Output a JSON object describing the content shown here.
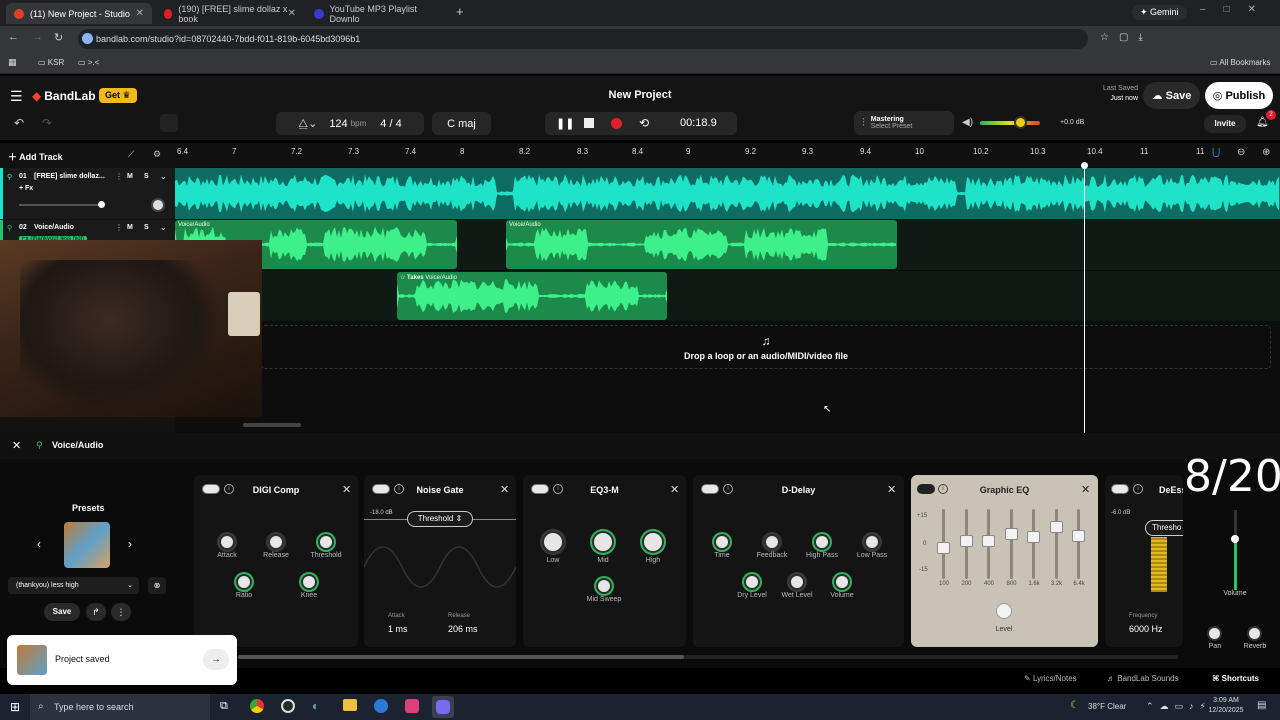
{
  "browser": {
    "tabs": [
      {
        "title": "(11) New Project - Studio",
        "active": true
      },
      {
        "title": "(190) [FREE] slime dollaz x book",
        "active": false
      },
      {
        "title": "YouTube MP3 Playlist Downlo",
        "active": false
      }
    ],
    "gemini_label": "Gemini",
    "url": "bandlab.com/studio?id=08702440-7bdd-f011-819b-6045bd3096b1",
    "bookmarks": [
      "KSR",
      ">.<"
    ],
    "all_bookmarks": "All Bookmarks"
  },
  "app": {
    "brand": "BandLab",
    "get_label": "Get",
    "project_title": "New Project",
    "bpm": "124",
    "bpm_unit": "bpm",
    "time_sig": "4 / 4",
    "key": "C maj",
    "time": "00:18.9",
    "mastering_title": "Mastering",
    "mastering_sub": "Select Preset",
    "master_db": "+0.0 dB",
    "last_saved_label": "Last Saved",
    "last_saved_value": "Just now",
    "save_label": "Save",
    "publish_label": "Publish",
    "invite_label": "Invite",
    "notif_count": "2",
    "colors": {
      "accent": "#1ee3c8",
      "green": "#24c46a",
      "record": "#e01e2b",
      "brand": "#f5452c",
      "gold": "#f0b91c"
    }
  },
  "tracks": {
    "add_track": "Add Track",
    "items": [
      {
        "number": "01",
        "name": "[FREE] slime dollaz...",
        "fx": "+ Fx",
        "m": "M",
        "s": "S"
      },
      {
        "number": "02",
        "name": "Voice/Audio",
        "fx": "Fx (thankyou) less high",
        "m": "M",
        "s": "S"
      }
    ]
  },
  "ruler": [
    "6.4",
    "7",
    "7.2",
    "7.3",
    "7.4",
    "8",
    "8.2",
    "8.3",
    "8.4",
    "9",
    "9.2",
    "9.3",
    "9.4",
    "10",
    "10.2",
    "10.3",
    "10.4",
    "11",
    "11"
  ],
  "clips": {
    "voice1": "Voice/Audio",
    "voice2": "Voice/Audio",
    "takes": "Takes",
    "takes_name": "Voice/Audio"
  },
  "drop_text": "Drop a loop or an audio/MIDI/video file",
  "fx_panel": {
    "track_name": "Voice/Audio",
    "presets_title": "Presets",
    "preset_name": "(thankyou) less high",
    "save_label": "Save",
    "overlay_counter": "8/20",
    "cards": {
      "digicomp": {
        "title": "DIGI Comp",
        "knobs": [
          "Attack",
          "Release",
          "Threshold",
          "Ratio",
          "Knee"
        ]
      },
      "noisegate": {
        "title": "Noise Gate",
        "threshold_label": "Threshold",
        "db": "-18.0 dB",
        "attack_label": "Attack",
        "attack_value": "1 ms",
        "release_label": "Release",
        "release_value": "206 ms"
      },
      "eq3m": {
        "title": "EQ3-M",
        "knobs": [
          "Low",
          "Mid",
          "High",
          "Mid Sweep"
        ]
      },
      "ddelay": {
        "title": "D-Delay",
        "knobs": [
          "Time",
          "Feedback",
          "High Pass",
          "Low Pass",
          "Dry Level",
          "Wet Level",
          "Volume"
        ]
      },
      "graphiceq": {
        "title": "Graphic EQ",
        "scale": [
          "+15",
          "0",
          "-15"
        ],
        "bands": [
          "100",
          "200",
          "400",
          "800",
          "1.6k",
          "3.2k",
          "6.4k"
        ],
        "level_label": "Level"
      },
      "deess": {
        "title": "DeEss",
        "db": "-6.0 dB",
        "threshold_label": "Thresho",
        "freq_label": "Frequency",
        "freq_value": "6000 Hz"
      }
    },
    "volume_label": "Volume",
    "pan_label": "Pan",
    "reverb_label": "Reverb"
  },
  "toast": {
    "text": "Project saved"
  },
  "footer": {
    "lyrics": "Lyrics/Notes",
    "sounds": "BandLab Sounds",
    "shortcuts": "Shortcuts"
  },
  "taskbar": {
    "search": "Type here to search",
    "weather": "38°F Clear",
    "time": "3:09 AM",
    "date": "12/20/2025"
  }
}
